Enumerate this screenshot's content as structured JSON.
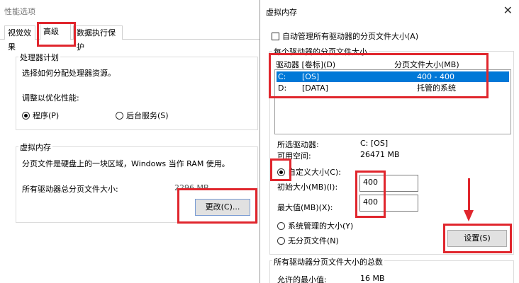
{
  "perf_dialog": {
    "title": "性能选项",
    "tabs": [
      "视觉效果",
      "高级",
      "数据执行保护"
    ],
    "scheduling": {
      "group_label": "处理器计划",
      "description": "选择如何分配处理器资源。",
      "adjust_label": "调整以优化性能:",
      "option_programs": "程序(P)",
      "option_background": "后台服务(S)",
      "selected": "程序(P)"
    },
    "virtual_memory": {
      "group_label": "虚拟内存",
      "description": "分页文件是硬盘上的一块区域，Windows 当作 RAM 使用。",
      "total_label": "所有驱动器总分页文件大小:",
      "total_value": "2296 MB",
      "change_button": "更改(C)..."
    }
  },
  "vm_dialog": {
    "title": "虚拟内存",
    "close_icon": "close-icon",
    "auto_manage_label": "自动管理所有驱动器的分页文件大小(A)",
    "auto_manage_checked": false,
    "per_drive_label": "每个驱动器的分页文件大小",
    "columns": [
      "驱动器 [卷标](D)",
      "分页文件大小(MB)"
    ],
    "drives": [
      {
        "drive": "C:",
        "label": "[OS]",
        "size": "400 - 400",
        "selected": true
      },
      {
        "drive": "D:",
        "label": "[DATA]",
        "size": "托管的系统",
        "selected": false
      }
    ],
    "selected_drive_label": "所选驱动器:",
    "selected_drive_value": "C:  [OS]",
    "free_space_label": "可用空间:",
    "free_space_value": "26471 MB",
    "custom_size_label": "自定义大小(C):",
    "initial_size_label": "初始大小(MB)(I):",
    "initial_size_value": "400",
    "max_size_label": "最大值(MB)(X):",
    "max_size_value": "400",
    "system_managed_label": "系统管理的大小(Y)",
    "no_paging_label": "无分页文件(N)",
    "set_button": "设置(S)",
    "total_group_label": "所有驱动器分页文件大小的总数",
    "min_allowed_label": "允许的最小值:",
    "min_allowed_value": "16 MB"
  },
  "colors": {
    "highlight_red": "#e0262d",
    "selection_blue": "#0078d7"
  }
}
